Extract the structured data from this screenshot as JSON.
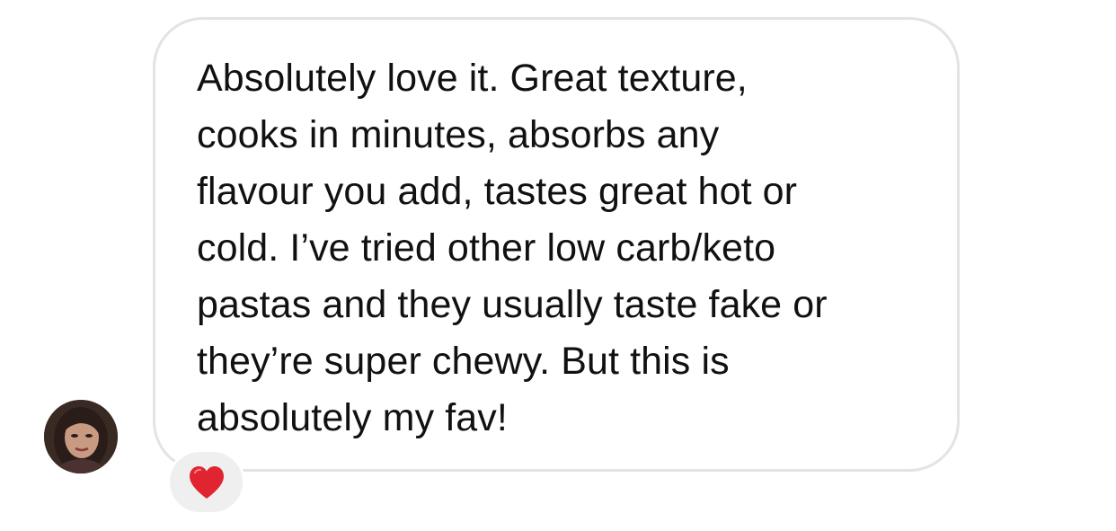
{
  "message": {
    "lines": [
      "Absolutely love it. Great texture,",
      "cooks in minutes, absorbs any",
      "flavour you add, tastes great hot or",
      "cold. I’ve tried other low carb/keto",
      "pastas and they usually taste fake or",
      "they’re super chewy. But this is",
      "absolutely my fav!"
    ]
  },
  "reaction": {
    "icon": "red-heart-icon",
    "color": "#e02430"
  },
  "avatar": {
    "icon": "user-avatar"
  },
  "colors": {
    "bubble_border": "#e3e3e3",
    "reaction_background": "#efefef",
    "text": "#111111"
  }
}
